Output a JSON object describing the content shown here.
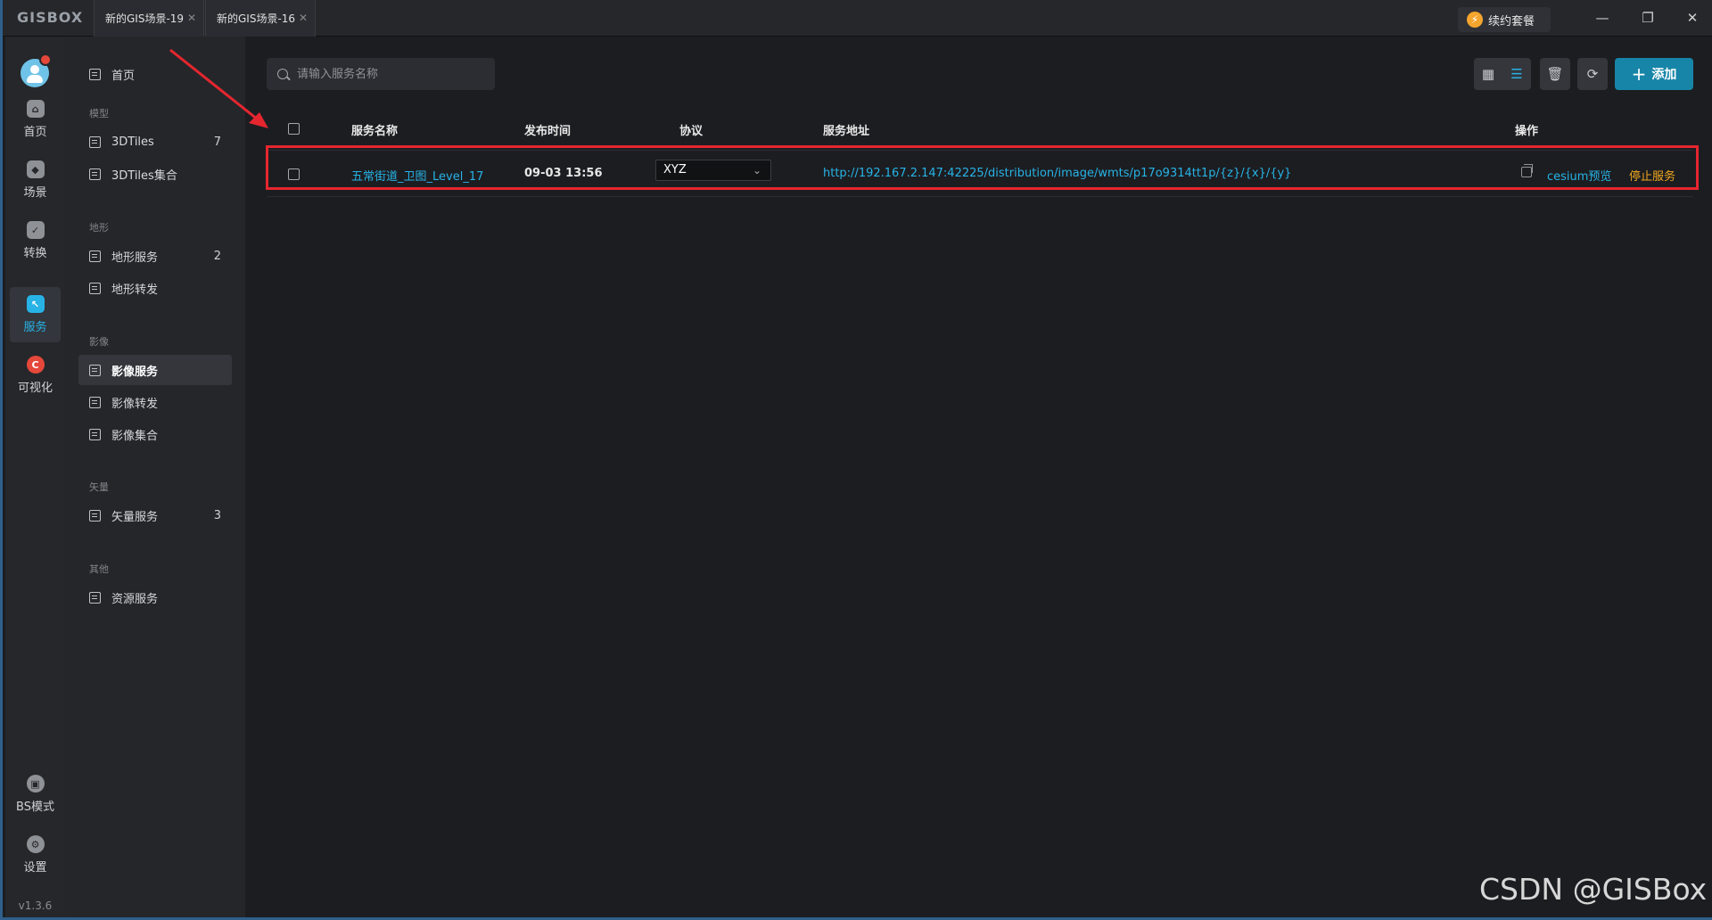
{
  "app": {
    "logo": "GISBOX",
    "tabs": [
      {
        "label": "新的GIS场景-19"
      },
      {
        "label": "新的GIS场景-16"
      }
    ],
    "renew_label": "续约套餐",
    "version": "v1.3.6"
  },
  "rail": {
    "items": [
      {
        "label": "首页"
      },
      {
        "label": "场景"
      },
      {
        "label": "转换"
      },
      {
        "label": "服务"
      },
      {
        "label": "可视化"
      },
      {
        "label": "BS模式"
      },
      {
        "label": "设置"
      }
    ]
  },
  "subnav": {
    "home": "首页",
    "groups": {
      "model": "模型",
      "terrain": "地形",
      "imagery": "影像",
      "vector": "矢量",
      "other": "其他"
    },
    "items": {
      "tiles3d": {
        "label": "3DTiles",
        "count": "7"
      },
      "tiles3d_set": {
        "label": "3DTiles集合"
      },
      "terrain_service": {
        "label": "地形服务",
        "count": "2"
      },
      "terrain_forward": {
        "label": "地形转发"
      },
      "imagery_service": {
        "label": "影像服务"
      },
      "imagery_forward": {
        "label": "影像转发"
      },
      "imagery_set": {
        "label": "影像集合"
      },
      "vector_service": {
        "label": "矢量服务",
        "count": "3"
      },
      "resource_service": {
        "label": "资源服务"
      }
    }
  },
  "main": {
    "search_placeholder": "请输入服务名称",
    "add_label": "添加",
    "columns": {
      "name": "服务名称",
      "time": "发布时间",
      "protocol": "协议",
      "address": "服务地址",
      "actions": "操作"
    },
    "rows": [
      {
        "name": "五常街道_卫图_Level_17",
        "time": "09-03 13:56",
        "protocol": "XYZ",
        "address": "http://192.167.2.147:42225/distribution/image/wmts/p17o9314tt1p/{z}/{x}/{y}",
        "preview": "cesium预览",
        "stop": "停止服务"
      }
    ]
  },
  "watermark": "CSDN @GISBox",
  "colors": {
    "accent": "#27b3e6",
    "primary_button": "#1785a8",
    "warning": "#f0a81e",
    "annotation": "#e5262f"
  }
}
